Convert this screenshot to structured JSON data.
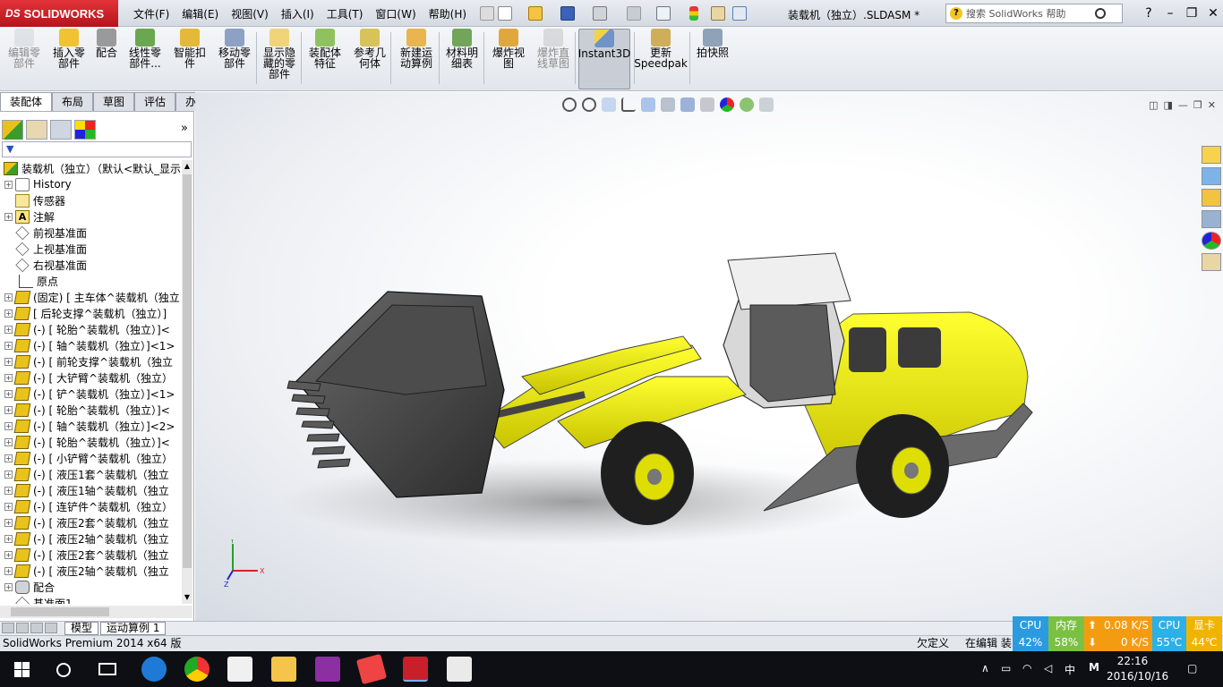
{
  "app": {
    "brand": "SOLIDWORKS",
    "brand_prefix": "DS",
    "document_title": "装载机（独立）.SLDASM *"
  },
  "menu": [
    "文件(F)",
    "编辑(E)",
    "视图(V)",
    "插入(I)",
    "工具(T)",
    "窗口(W)",
    "帮助(H)"
  ],
  "help_search": {
    "placeholder": "搜索 SolidWorks 帮助"
  },
  "commands": [
    {
      "label": "编辑零\n部件",
      "icon": "edit-component-icon",
      "enabled": false
    },
    {
      "label": "插入零\n部件",
      "icon": "insert-component-icon",
      "enabled": true
    },
    {
      "label": "配合",
      "icon": "mate-icon",
      "enabled": true
    },
    {
      "label": "线性零\n部件...",
      "icon": "linear-pattern-icon",
      "enabled": true
    },
    {
      "label": "智能扣\n件",
      "icon": "smart-fastener-icon",
      "enabled": true
    },
    {
      "label": "移动零\n部件",
      "icon": "move-component-icon",
      "enabled": true
    },
    {
      "label": "显示隐\n藏的零\n部件",
      "icon": "show-hidden-icon",
      "enabled": true
    },
    {
      "label": "装配体\n特征",
      "icon": "assembly-feature-icon",
      "enabled": true
    },
    {
      "label": "参考几\n何体",
      "icon": "reference-geometry-icon",
      "enabled": true
    },
    {
      "label": "新建运\n动算例",
      "icon": "new-motion-study-icon",
      "enabled": true
    },
    {
      "label": "材料明\n细表",
      "icon": "bom-icon",
      "enabled": true
    },
    {
      "label": "爆炸视\n图",
      "icon": "exploded-view-icon",
      "enabled": true
    },
    {
      "label": "爆炸直\n线草图",
      "icon": "explode-line-sketch-icon",
      "enabled": false
    },
    {
      "label": "Instant3D",
      "icon": "instant3d-icon",
      "enabled": true,
      "active": true
    },
    {
      "label": "更新\nSpeedpak",
      "icon": "speedpak-icon",
      "enabled": true
    },
    {
      "label": "拍快照",
      "icon": "snapshot-icon",
      "enabled": true
    }
  ],
  "tabs": [
    "装配体",
    "布局",
    "草图",
    "评估",
    "办公室产品"
  ],
  "filter_label": "▼",
  "tree": {
    "root": "装载机（独立）（默认<默认_显示",
    "items": [
      {
        "label": "History",
        "icon": "history-icon",
        "exp": true
      },
      {
        "label": "传感器",
        "icon": "sensor-icon",
        "exp": false
      },
      {
        "label": "注解",
        "icon": "annotation-icon",
        "exp": true
      },
      {
        "label": "前视基准面",
        "icon": "plane-icon",
        "exp": false
      },
      {
        "label": "上视基准面",
        "icon": "plane-icon",
        "exp": false
      },
      {
        "label": "右视基准面",
        "icon": "plane-icon",
        "exp": false
      },
      {
        "label": "原点",
        "icon": "origin-icon",
        "exp": false
      },
      {
        "label": "(固定) [ 主车体^装载机（独立",
        "icon": "part-icon",
        "exp": true
      },
      {
        "label": "[ 后轮支撑^装载机（独立）]",
        "icon": "part-icon",
        "exp": true
      },
      {
        "label": "(-) [ 轮胎^装载机（独立）]<",
        "icon": "part-icon",
        "exp": true
      },
      {
        "label": "(-) [ 轴^装载机（独立）]<1>",
        "icon": "part-icon",
        "exp": true
      },
      {
        "label": "(-) [ 前轮支撑^装载机（独立",
        "icon": "part-icon",
        "exp": true
      },
      {
        "label": "(-) [ 大铲臂^装载机（独立）",
        "icon": "part-icon",
        "exp": true
      },
      {
        "label": "(-) [ 铲^装载机（独立）]<1>",
        "icon": "part-icon",
        "exp": true
      },
      {
        "label": "(-) [ 轮胎^装载机（独立）]<",
        "icon": "part-icon",
        "exp": true
      },
      {
        "label": "(-) [ 轴^装载机（独立）]<2>",
        "icon": "part-icon",
        "exp": true
      },
      {
        "label": "(-) [ 轮胎^装载机（独立）]<",
        "icon": "part-icon",
        "exp": true
      },
      {
        "label": "(-) [ 小铲臂^装载机（独立）",
        "icon": "part-icon",
        "exp": true
      },
      {
        "label": "(-) [ 液压1套^装载机（独立",
        "icon": "part-icon",
        "exp": true
      },
      {
        "label": "(-) [ 液压1轴^装载机（独立",
        "icon": "part-icon",
        "exp": true
      },
      {
        "label": "(-) [ 连铲件^装载机（独立）",
        "icon": "part-icon",
        "exp": true
      },
      {
        "label": "(-) [ 液压2套^装载机（独立",
        "icon": "part-icon",
        "exp": true
      },
      {
        "label": "(-) [ 液压2轴^装载机（独立",
        "icon": "part-icon",
        "exp": true
      },
      {
        "label": "(-) [ 液压2套^装载机（独立",
        "icon": "part-icon",
        "exp": true
      },
      {
        "label": "(-) [ 液压2轴^装载机（独立",
        "icon": "part-icon",
        "exp": true
      },
      {
        "label": "配合",
        "icon": "mates-icon",
        "exp": true
      },
      {
        "label": "基准面1",
        "icon": "plane-icon",
        "exp": false
      }
    ]
  },
  "bottom_tabs": [
    "模型",
    "运动算例 1"
  ],
  "status": {
    "product": "SolidWorks Premium 2014 x64 版",
    "state": "欠定义",
    "mode": "在编辑 装"
  },
  "monitor": {
    "cpu_label": "CPU",
    "cpu_value": "42%",
    "mem_label": "内存",
    "mem_value": "58%",
    "net_up": "0.08 K/S",
    "net_down": "0 K/S",
    "cpu_temp_label": "CPU",
    "cpu_temp": "55℃",
    "gpu_label": "显卡",
    "gpu_temp": "44℃"
  },
  "taskbar": {
    "ime": "中",
    "time": "22:16",
    "date": "2016/10/16"
  },
  "triad": {
    "x": "X",
    "y": "Y",
    "z": "Z"
  },
  "colors": {
    "brand": "#c8202a",
    "machine_yellow": "#ecec00",
    "cpu_cell": "#2b9be0",
    "mem_cell": "#7ac143",
    "net_cell": "#f39c12",
    "gpu_cell": "#f0b400"
  }
}
